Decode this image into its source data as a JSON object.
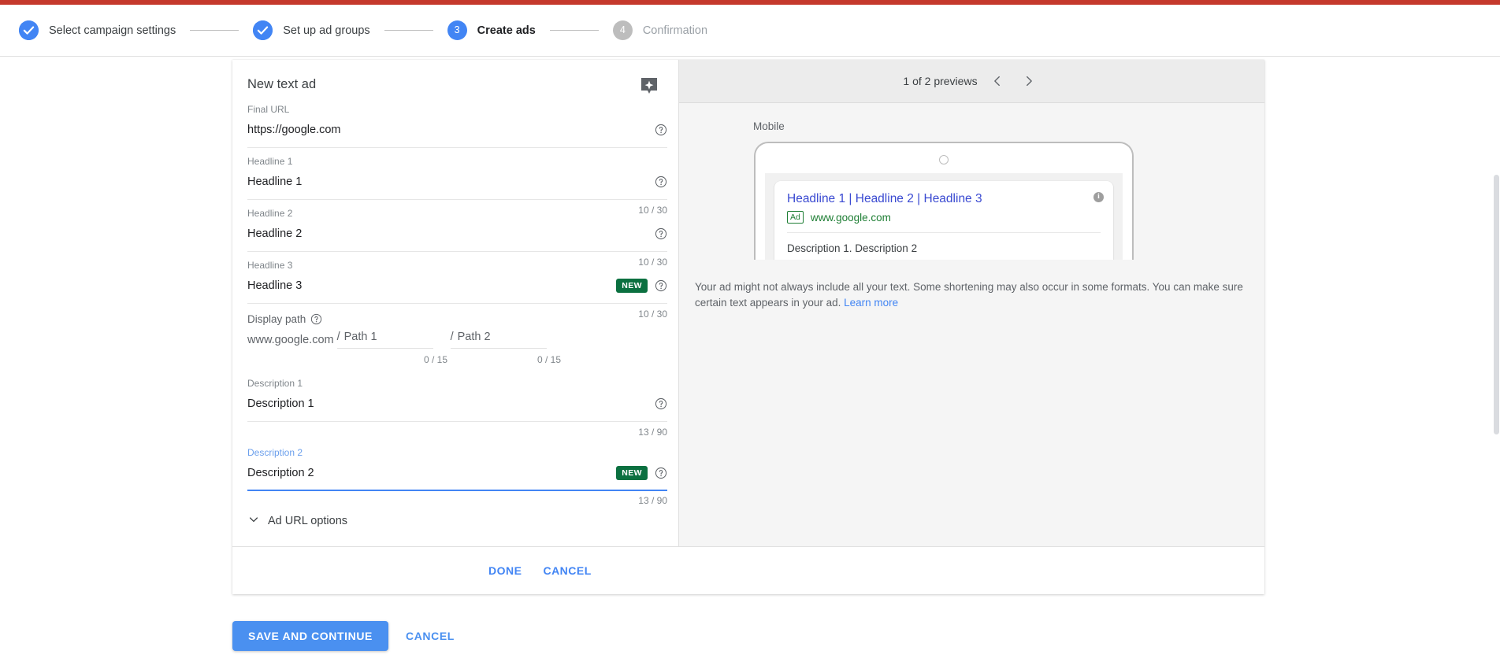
{
  "theme": {
    "accent_blue": "#4285f4",
    "top_bar_red": "#c5392c",
    "badge_green": "#0b7040",
    "ad_green": "#1e7e34",
    "headline_blue": "#3949d1"
  },
  "stepper": {
    "steps": [
      {
        "marker": "check",
        "label": "Select campaign settings",
        "state": "done"
      },
      {
        "marker": "check",
        "label": "Set up ad groups",
        "state": "done"
      },
      {
        "marker": "3",
        "label": "Create ads",
        "state": "active"
      },
      {
        "marker": "4",
        "label": "Confirmation",
        "state": "todo"
      }
    ]
  },
  "ad_form": {
    "title": "New text ad",
    "fields": [
      {
        "label": "Final URL",
        "value": "https://google.com",
        "counter": "",
        "badge": "",
        "help": true,
        "focused": false
      },
      {
        "label": "Headline 1",
        "value": "Headline 1",
        "counter": "10 / 30",
        "badge": "",
        "help": true,
        "focused": false
      },
      {
        "label": "Headline 2",
        "value": "Headline 2",
        "counter": "10 / 30",
        "badge": "",
        "help": true,
        "focused": false
      },
      {
        "label": "Headline 3",
        "value": "Headline 3",
        "counter": "10 / 30",
        "badge": "NEW",
        "help": true,
        "focused": false
      }
    ],
    "display_path": {
      "label": "Display path",
      "domain": "www.google.com",
      "segments": [
        {
          "slash": "/",
          "placeholder": "Path 1",
          "counter": "0 / 15"
        },
        {
          "slash": "/",
          "placeholder": "Path 2",
          "counter": "0 / 15"
        }
      ]
    },
    "descriptions": [
      {
        "label": "Description 1",
        "value": "Description 1",
        "counter": "13 / 90",
        "badge": "",
        "help": true,
        "focused": false
      },
      {
        "label": "Description 2",
        "value": "Description 2",
        "counter": "13 / 90",
        "badge": "NEW",
        "help": true,
        "focused": true
      }
    ],
    "ad_url_options_label": "Ad URL options",
    "footer": {
      "done_label": "DONE",
      "cancel_label": "CANCEL"
    }
  },
  "preview": {
    "count_text": "1 of 2 previews",
    "prev_label": "‹",
    "next_label": "›",
    "device_label": "Mobile",
    "ad": {
      "headline": "Headline 1 | Headline 2 | Headline 3",
      "tag": "Ad",
      "url": "www.google.com",
      "description": "Description 1. Description 2",
      "info_glyph": "i"
    },
    "disclaimer_text": "Your ad might not always include all your text. Some shortening may also occur in some formats. You can make sure certain text appears in your ad. ",
    "disclaimer_link": "Learn more"
  },
  "page_actions": {
    "save_label": "SAVE AND CONTINUE",
    "cancel_label": "CANCEL"
  }
}
